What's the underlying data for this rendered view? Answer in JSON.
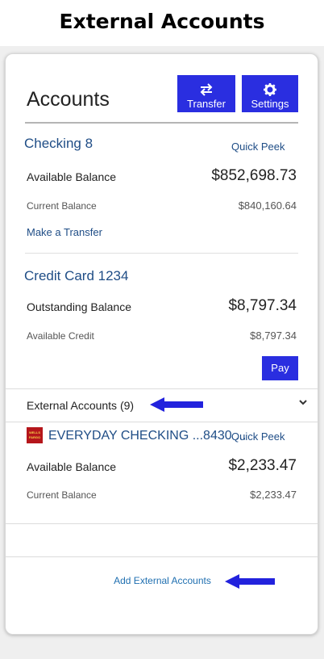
{
  "page_title": "External Accounts",
  "header": {
    "title": "Accounts",
    "transfer_label": "Transfer",
    "settings_label": "Settings"
  },
  "checking": {
    "name": "Checking 8",
    "quick_peek": "Quick Peek",
    "available_label": "Available Balance",
    "available_value": "$852,698.73",
    "current_label": "Current Balance",
    "current_value": "$840,160.64",
    "make_transfer": "Make a Transfer"
  },
  "credit": {
    "name": "Credit Card 1234",
    "outstanding_label": "Outstanding Balance",
    "outstanding_value": "$8,797.34",
    "available_label": "Available Credit",
    "available_value": "$8,797.34",
    "pay_label": "Pay"
  },
  "external": {
    "header_label": "External Accounts (9)",
    "logo_text": "WELLS FARGO",
    "account_name": "EVERYDAY CHECKING ...8430 ...",
    "quick_peek": "Quick Peek",
    "available_label": "Available Balance",
    "available_value": "$2,233.47",
    "current_label": "Current Balance",
    "current_value": "$2,233.47",
    "add_link": "Add External Accounts"
  },
  "colors": {
    "accent": "#2a2ee0",
    "link": "#1f4d86",
    "arrow": "#2222dd"
  }
}
